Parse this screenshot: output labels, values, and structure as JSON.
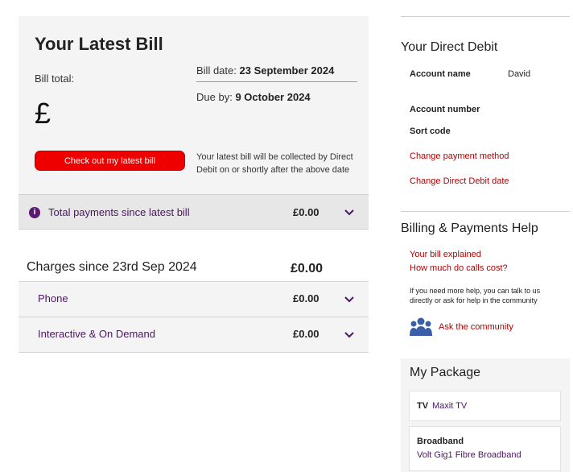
{
  "latest_bill": {
    "title": "Your Latest Bill",
    "total_label": "Bill total:",
    "currency_symbol": "£",
    "bill_date_label": "Bill date:",
    "bill_date_value": "23 September 2024",
    "due_label": "Due by:",
    "due_value": "9 October 2024",
    "button_label": "Check out my latest bill",
    "collection_note": "Your latest bill will be collected by Direct Debit on or shortly after the above date"
  },
  "payments": {
    "label": "Total payments since latest bill",
    "amount": "£0.00",
    "icon": "info-icon"
  },
  "charges": {
    "title": "Charges since 23rd Sep 2024",
    "amount": "£0.00",
    "rows": [
      {
        "label": "Phone",
        "amount": "£0.00"
      },
      {
        "label": "Interactive & On Demand",
        "amount": "£0.00"
      }
    ]
  },
  "direct_debit": {
    "heading": "Your Direct Debit",
    "account_name_label": "Account name",
    "account_name_value": "David",
    "account_number_label": "Account number",
    "sort_code_label": "Sort code",
    "links": [
      "Change payment method",
      "Change Direct Debit date"
    ]
  },
  "billing_help": {
    "heading": "Billing & Payments Help",
    "links": [
      "Your bill explained",
      "How much do calls cost?"
    ],
    "note": "If you need more help, you can talk to us directly or ask for help in the community",
    "community_link": "Ask the community",
    "community_icon": "community-icon"
  },
  "package": {
    "heading": "My Package",
    "tv_label": "TV",
    "tv_value": "Maxit TV",
    "broadband_label": "Broadband",
    "broadband_value": "Volt Gig1 Fibre Broadband"
  },
  "colors": {
    "accent_red": "#ee0000",
    "link_red": "#b40000",
    "brand_purple": "#4a1760",
    "panel_grey": "#f4f4f4"
  }
}
